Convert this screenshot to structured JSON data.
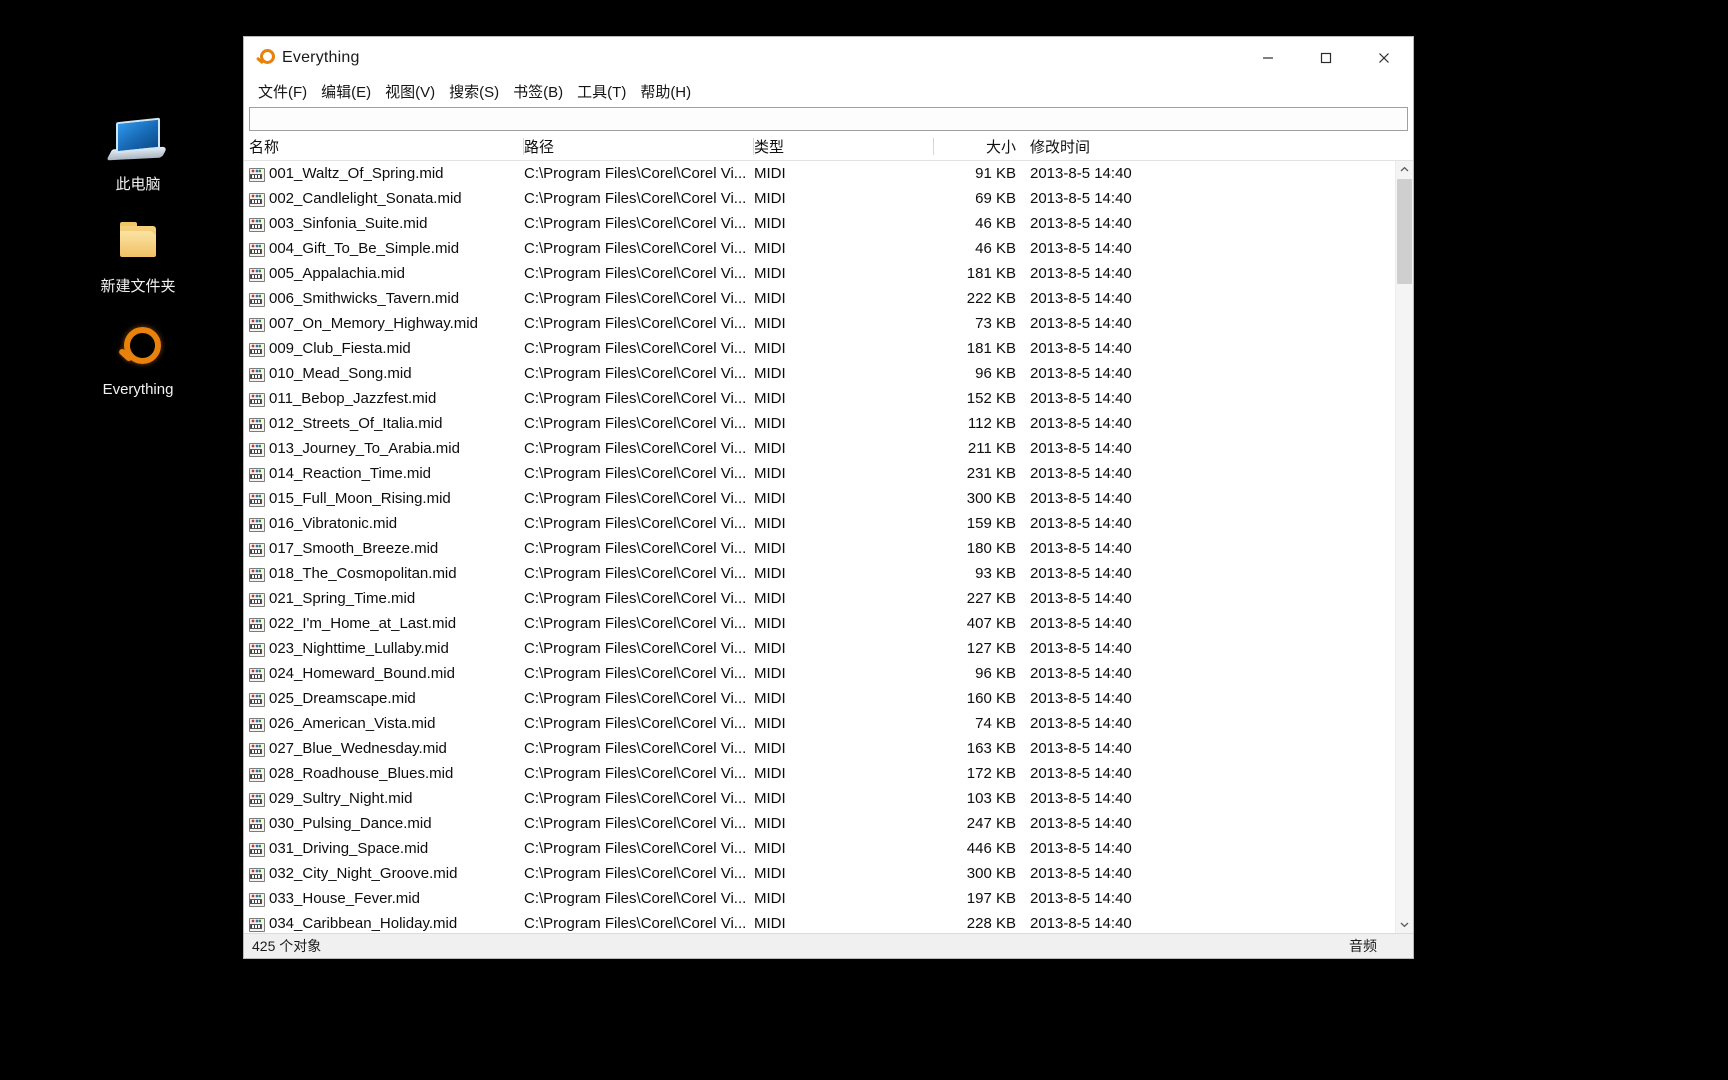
{
  "desktop": {
    "icons": [
      {
        "label": "此电脑",
        "icon": "this-pc-icon"
      },
      {
        "label": "新建文件夹",
        "icon": "folder-icon"
      },
      {
        "label": "Everything",
        "icon": "magnifier-icon"
      }
    ]
  },
  "window": {
    "title": "Everything",
    "icon": "magnifier-icon",
    "controls": {
      "minimize": "minimize-icon",
      "maximize": "maximize-icon",
      "close": "close-icon"
    },
    "menu": [
      "文件(F)",
      "编辑(E)",
      "视图(V)",
      "搜索(S)",
      "书签(B)",
      "工具(T)",
      "帮助(H)"
    ],
    "search": {
      "value": "",
      "placeholder": ""
    },
    "columns": {
      "name": "名称",
      "path": "路径",
      "type": "类型",
      "size": "大小",
      "date": "修改时间"
    },
    "rows": [
      {
        "name": "001_Waltz_Of_Spring.mid",
        "path": "C:\\Program Files\\Corel\\Corel Vi...",
        "type": "MIDI",
        "size": "91 KB",
        "date": "2013-8-5 14:40"
      },
      {
        "name": "002_Candlelight_Sonata.mid",
        "path": "C:\\Program Files\\Corel\\Corel Vi...",
        "type": "MIDI",
        "size": "69 KB",
        "date": "2013-8-5 14:40"
      },
      {
        "name": "003_Sinfonia_Suite.mid",
        "path": "C:\\Program Files\\Corel\\Corel Vi...",
        "type": "MIDI",
        "size": "46 KB",
        "date": "2013-8-5 14:40"
      },
      {
        "name": "004_Gift_To_Be_Simple.mid",
        "path": "C:\\Program Files\\Corel\\Corel Vi...",
        "type": "MIDI",
        "size": "46 KB",
        "date": "2013-8-5 14:40"
      },
      {
        "name": "005_Appalachia.mid",
        "path": "C:\\Program Files\\Corel\\Corel Vi...",
        "type": "MIDI",
        "size": "181 KB",
        "date": "2013-8-5 14:40"
      },
      {
        "name": "006_Smithwicks_Tavern.mid",
        "path": "C:\\Program Files\\Corel\\Corel Vi...",
        "type": "MIDI",
        "size": "222 KB",
        "date": "2013-8-5 14:40"
      },
      {
        "name": "007_On_Memory_Highway.mid",
        "path": "C:\\Program Files\\Corel\\Corel Vi...",
        "type": "MIDI",
        "size": "73 KB",
        "date": "2013-8-5 14:40"
      },
      {
        "name": "009_Club_Fiesta.mid",
        "path": "C:\\Program Files\\Corel\\Corel Vi...",
        "type": "MIDI",
        "size": "181 KB",
        "date": "2013-8-5 14:40"
      },
      {
        "name": "010_Mead_Song.mid",
        "path": "C:\\Program Files\\Corel\\Corel Vi...",
        "type": "MIDI",
        "size": "96 KB",
        "date": "2013-8-5 14:40"
      },
      {
        "name": "011_Bebop_Jazzfest.mid",
        "path": "C:\\Program Files\\Corel\\Corel Vi...",
        "type": "MIDI",
        "size": "152 KB",
        "date": "2013-8-5 14:40"
      },
      {
        "name": "012_Streets_Of_Italia.mid",
        "path": "C:\\Program Files\\Corel\\Corel Vi...",
        "type": "MIDI",
        "size": "112 KB",
        "date": "2013-8-5 14:40"
      },
      {
        "name": "013_Journey_To_Arabia.mid",
        "path": "C:\\Program Files\\Corel\\Corel Vi...",
        "type": "MIDI",
        "size": "211 KB",
        "date": "2013-8-5 14:40"
      },
      {
        "name": "014_Reaction_Time.mid",
        "path": "C:\\Program Files\\Corel\\Corel Vi...",
        "type": "MIDI",
        "size": "231 KB",
        "date": "2013-8-5 14:40"
      },
      {
        "name": "015_Full_Moon_Rising.mid",
        "path": "C:\\Program Files\\Corel\\Corel Vi...",
        "type": "MIDI",
        "size": "300 KB",
        "date": "2013-8-5 14:40"
      },
      {
        "name": "016_Vibratonic.mid",
        "path": "C:\\Program Files\\Corel\\Corel Vi...",
        "type": "MIDI",
        "size": "159 KB",
        "date": "2013-8-5 14:40"
      },
      {
        "name": "017_Smooth_Breeze.mid",
        "path": "C:\\Program Files\\Corel\\Corel Vi...",
        "type": "MIDI",
        "size": "180 KB",
        "date": "2013-8-5 14:40"
      },
      {
        "name": "018_The_Cosmopolitan.mid",
        "path": "C:\\Program Files\\Corel\\Corel Vi...",
        "type": "MIDI",
        "size": "93 KB",
        "date": "2013-8-5 14:40"
      },
      {
        "name": "021_Spring_Time.mid",
        "path": "C:\\Program Files\\Corel\\Corel Vi...",
        "type": "MIDI",
        "size": "227 KB",
        "date": "2013-8-5 14:40"
      },
      {
        "name": "022_I'm_Home_at_Last.mid",
        "path": "C:\\Program Files\\Corel\\Corel Vi...",
        "type": "MIDI",
        "size": "407 KB",
        "date": "2013-8-5 14:40"
      },
      {
        "name": "023_Nighttime_Lullaby.mid",
        "path": "C:\\Program Files\\Corel\\Corel Vi...",
        "type": "MIDI",
        "size": "127 KB",
        "date": "2013-8-5 14:40"
      },
      {
        "name": "024_Homeward_Bound.mid",
        "path": "C:\\Program Files\\Corel\\Corel Vi...",
        "type": "MIDI",
        "size": "96 KB",
        "date": "2013-8-5 14:40"
      },
      {
        "name": "025_Dreamscape.mid",
        "path": "C:\\Program Files\\Corel\\Corel Vi...",
        "type": "MIDI",
        "size": "160 KB",
        "date": "2013-8-5 14:40"
      },
      {
        "name": "026_American_Vista.mid",
        "path": "C:\\Program Files\\Corel\\Corel Vi...",
        "type": "MIDI",
        "size": "74 KB",
        "date": "2013-8-5 14:40"
      },
      {
        "name": "027_Blue_Wednesday.mid",
        "path": "C:\\Program Files\\Corel\\Corel Vi...",
        "type": "MIDI",
        "size": "163 KB",
        "date": "2013-8-5 14:40"
      },
      {
        "name": "028_Roadhouse_Blues.mid",
        "path": "C:\\Program Files\\Corel\\Corel Vi...",
        "type": "MIDI",
        "size": "172 KB",
        "date": "2013-8-5 14:40"
      },
      {
        "name": "029_Sultry_Night.mid",
        "path": "C:\\Program Files\\Corel\\Corel Vi...",
        "type": "MIDI",
        "size": "103 KB",
        "date": "2013-8-5 14:40"
      },
      {
        "name": "030_Pulsing_Dance.mid",
        "path": "C:\\Program Files\\Corel\\Corel Vi...",
        "type": "MIDI",
        "size": "247 KB",
        "date": "2013-8-5 14:40"
      },
      {
        "name": "031_Driving_Space.mid",
        "path": "C:\\Program Files\\Corel\\Corel Vi...",
        "type": "MIDI",
        "size": "446 KB",
        "date": "2013-8-5 14:40"
      },
      {
        "name": "032_City_Night_Groove.mid",
        "path": "C:\\Program Files\\Corel\\Corel Vi...",
        "type": "MIDI",
        "size": "300 KB",
        "date": "2013-8-5 14:40"
      },
      {
        "name": "033_House_Fever.mid",
        "path": "C:\\Program Files\\Corel\\Corel Vi...",
        "type": "MIDI",
        "size": "197 KB",
        "date": "2013-8-5 14:40"
      },
      {
        "name": "034_Caribbean_Holiday.mid",
        "path": "C:\\Program Files\\Corel\\Corel Vi...",
        "type": "MIDI",
        "size": "228 KB",
        "date": "2013-8-5 14:40"
      }
    ],
    "status": {
      "left": "425 个对象",
      "right": "音频"
    }
  },
  "colors": {
    "accent": "#e8820c",
    "window_bg": "#ffffff",
    "status_bg": "#f0f0f0",
    "desktop_bg": "#000000"
  }
}
